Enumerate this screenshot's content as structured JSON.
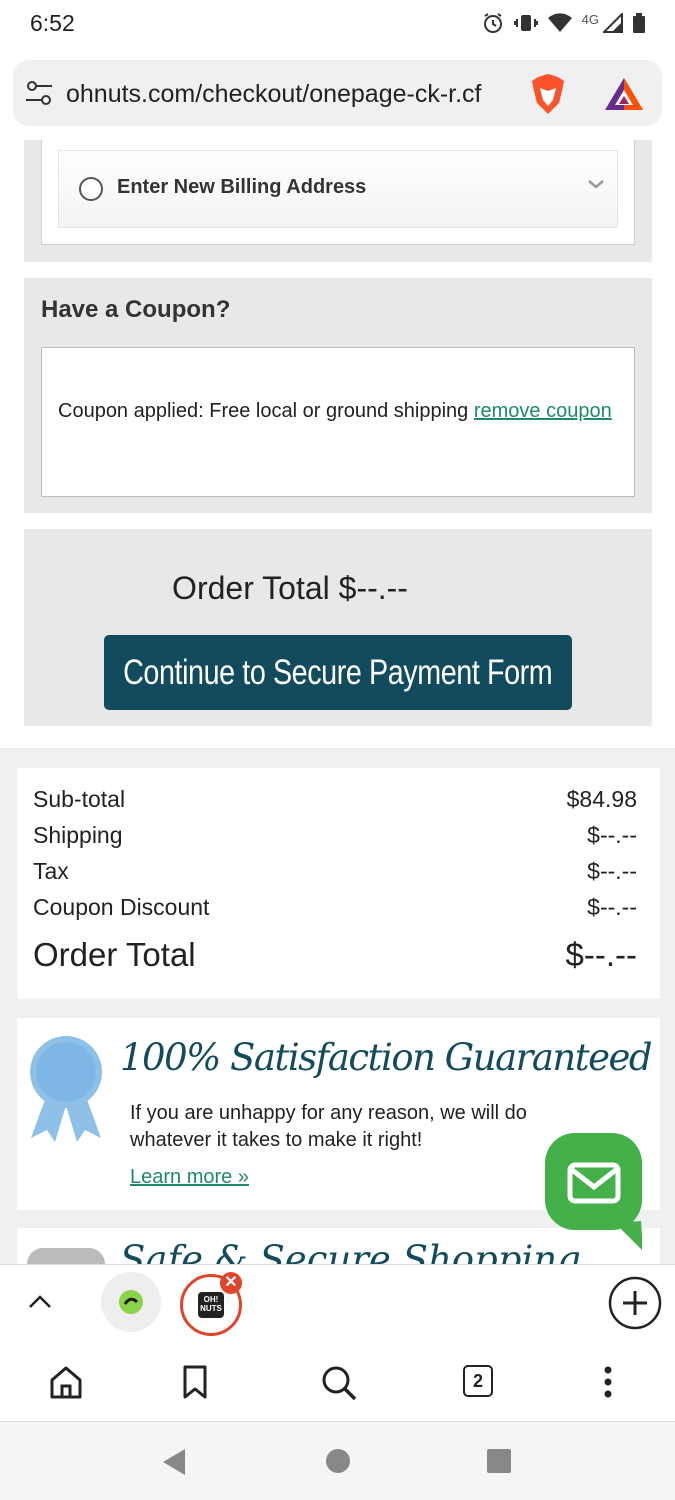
{
  "status_bar": {
    "time": "6:52",
    "network": "4G"
  },
  "browser": {
    "url": "ohnuts.com/checkout/onepage-ck-r.cf",
    "tab_count": "2",
    "tab_group_logo": "OH! NUTS"
  },
  "billing": {
    "option_label": "Enter New Billing Address"
  },
  "coupon": {
    "title": "Have a Coupon?",
    "applied_text": "Coupon applied: Free local or ground shipping",
    "remove_link": "remove coupon"
  },
  "order_panel": {
    "total_label": "Order Total $--.--",
    "pay_button": "Continue to Secure Payment Form"
  },
  "summary": {
    "rows": [
      {
        "label": "Sub-total",
        "value": "$84.98"
      },
      {
        "label": "Shipping",
        "value": "$--.--"
      },
      {
        "label": "Tax",
        "value": "$--.--"
      },
      {
        "label": "Coupon Discount",
        "value": "$--.--"
      }
    ],
    "total_label": "Order Total",
    "total_value": "$--.--"
  },
  "guarantee": {
    "title": "100% Satisfaction Guaranteed",
    "text": "If you are unhappy for any reason, we will do whatever it takes to make it right!",
    "link": "Learn more »"
  },
  "next_section": {
    "title": "Safe & Secure Shopping"
  },
  "colors": {
    "brand_teal": "#124b5e",
    "link_green": "#1f8a6a",
    "chat_green": "#44b04a",
    "panel_gray": "#e8e8e8"
  }
}
